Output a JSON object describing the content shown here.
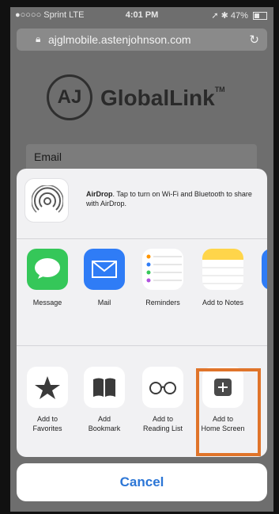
{
  "status_bar": {
    "carrier": "●○○○○ Sprint  LTE",
    "time": "4:01 PM",
    "battery_pct": "47%"
  },
  "browser": {
    "url": "ajglmobile.astenjohnson.com",
    "lock_icon": "lock-icon",
    "reload_icon": "reload-icon"
  },
  "page": {
    "logo_mark": "AJ",
    "logo_name": "GlobalLink",
    "logo_tm": "TM",
    "email_label": "Email"
  },
  "share_sheet": {
    "airdrop": {
      "title": "AirDrop",
      "description": ". Tap to turn on Wi-Fi and Bluetooth to share with AirDrop."
    },
    "apps": [
      {
        "label": "Message",
        "icon": "message-icon",
        "color": "#35c759"
      },
      {
        "label": "Mail",
        "icon": "mail-icon",
        "color": "#2f7cf6"
      },
      {
        "label": "Reminders",
        "icon": "reminders-icon",
        "color": "#ffffff"
      },
      {
        "label": "Add to Notes",
        "icon": "notes-icon",
        "color": "#ffd54a"
      }
    ],
    "actions": [
      {
        "label_line1": "Add to",
        "label_line2": "Favorites",
        "icon": "star-icon"
      },
      {
        "label_line1": "Add",
        "label_line2": "Bookmark",
        "icon": "book-icon"
      },
      {
        "label_line1": "Add to",
        "label_line2": "Reading List",
        "icon": "glasses-icon"
      },
      {
        "label_line1": "Add to",
        "label_line2": "Home Screen",
        "icon": "plus-square-icon"
      }
    ],
    "cancel_label": "Cancel"
  },
  "colors": {
    "highlight": "#e0742a",
    "cancel": "#2c76d6"
  }
}
